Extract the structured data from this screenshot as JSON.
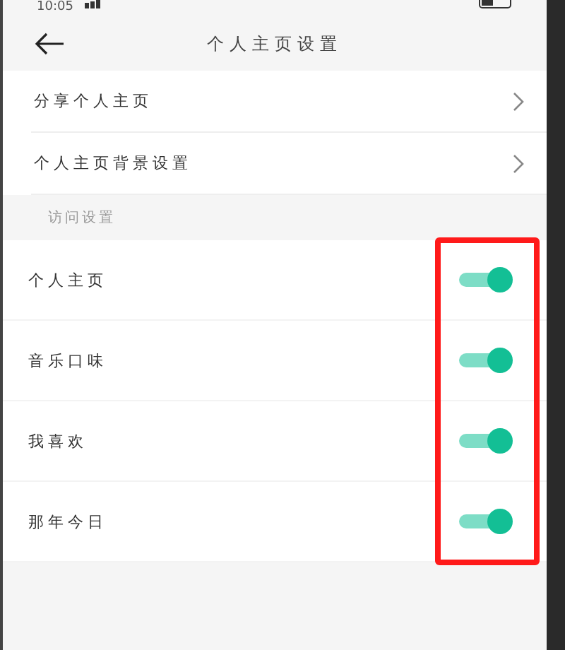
{
  "status_bar": {
    "time": "10:05"
  },
  "header": {
    "title": "个人主页设置"
  },
  "links": [
    {
      "label": "分享个人主页"
    },
    {
      "label": "个人主页背景设置"
    }
  ],
  "section": {
    "title": "访问设置"
  },
  "toggles": [
    {
      "label": "个人主页",
      "on": true
    },
    {
      "label": "音乐口味",
      "on": true
    },
    {
      "label": "我喜欢",
      "on": true
    },
    {
      "label": "那年今日",
      "on": true
    }
  ]
}
